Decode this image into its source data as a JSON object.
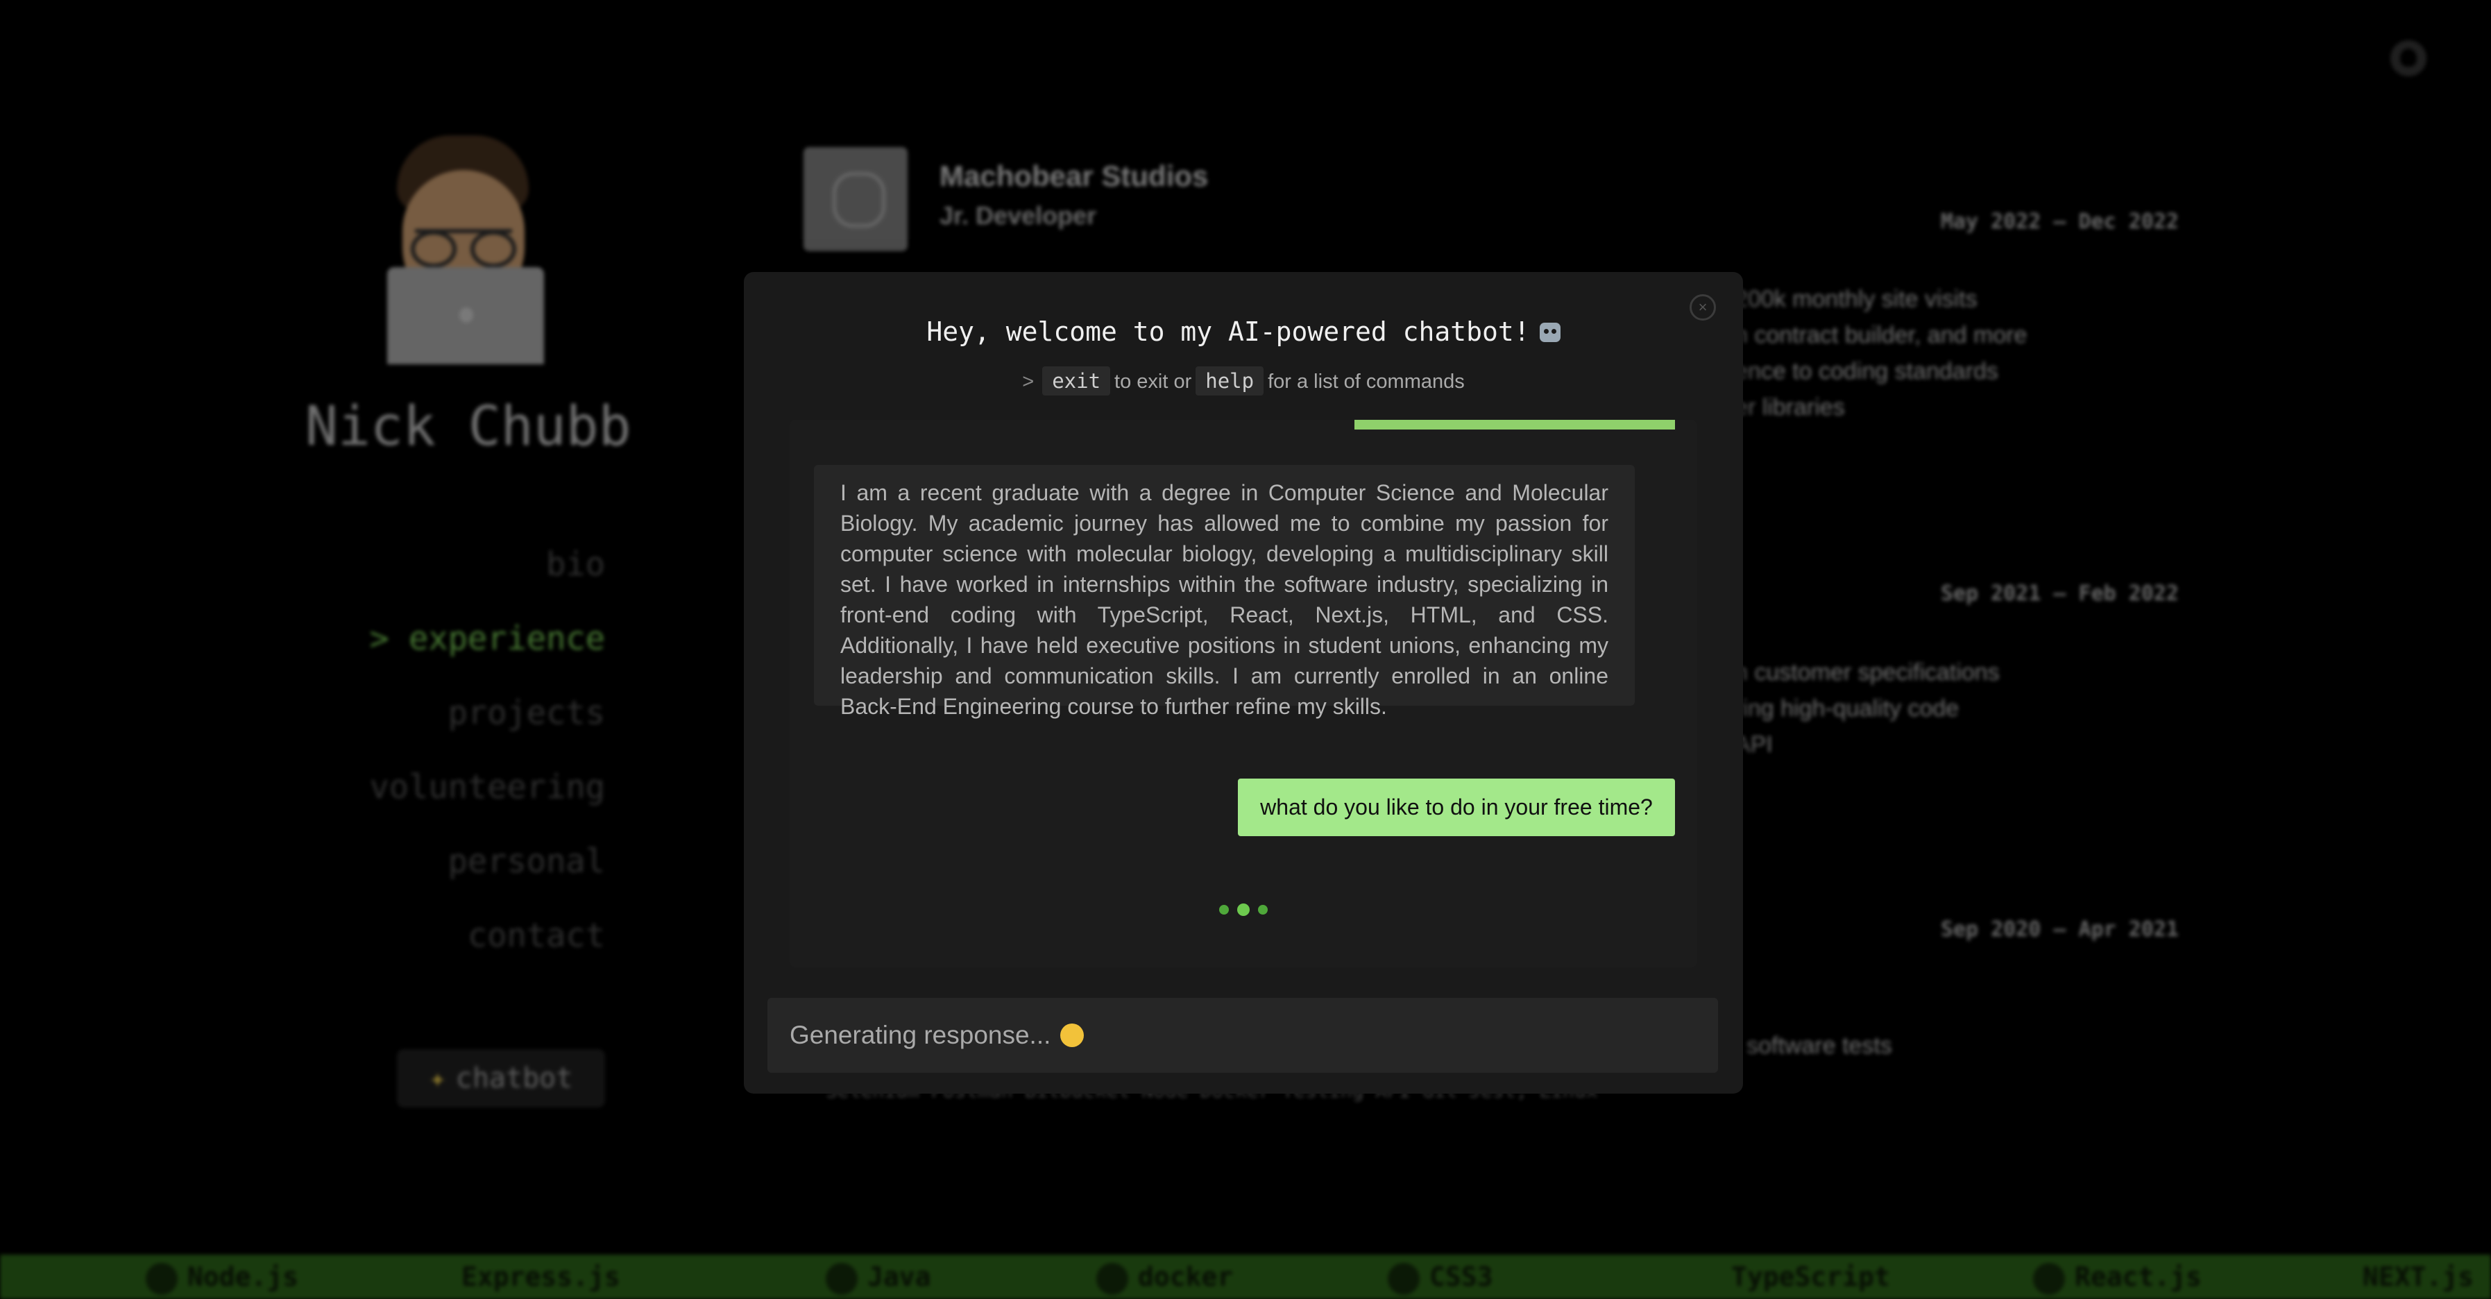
{
  "profile": {
    "name": "Nick Chubb"
  },
  "nav": {
    "items": [
      "bio",
      "experience",
      "projects",
      "volunteering",
      "personal",
      "contact"
    ],
    "active": "experience",
    "chatbot_label": "chatbot"
  },
  "experience": {
    "company": "Machobear Studios",
    "role": "Jr. Developer",
    "dates": [
      "May 2022 – Dec 2022",
      "Sep 2021 – Feb 2022",
      "Sep 2020 – Apr 2021"
    ],
    "bullets_1": [
      "200k monthly site visits",
      "n contract builder, and more",
      "ence to coding standards",
      "er libraries"
    ],
    "bullets_2": [
      "h customer specifications",
      "ring high-quality code",
      "API"
    ],
    "bullets_3": [
      "l software tests"
    ],
    "skills_line": "Selenium  Postman  Bitbucket  Node  Docker  Testing  API  Git  Jest, Linux"
  },
  "tech_ticker": [
    "Node.js",
    "Express.js",
    "Java",
    "docker",
    "CSS3",
    "TypeScript",
    "React.js",
    "NEXT.js"
  ],
  "chat": {
    "title": "Hey, welcome to my AI-powered chatbot!",
    "hint_prompt": ">",
    "hint_cmd_exit": "exit",
    "hint_text_1": "to exit or",
    "hint_cmd_help": "help",
    "hint_text_2": "for a list of commands",
    "bot_message": "I am a recent graduate with a degree in Computer Science and Molecular Biology. My academic journey has allowed me to combine my passion for computer science with molecular biology, developing a multidisciplinary skill set. I have worked in internships within the software industry, specializing in front-end coding with TypeScript, React, Next.js, HTML, and CSS. Additionally, I have held executive positions in student unions, enhancing my leadership and communication skills. I am currently enrolled in an online Back-End Engineering course to further refine my skills.",
    "user_message": "what do you like to do in your free time?",
    "input_status": "Generating response...",
    "close_label": "×"
  },
  "colors": {
    "accent": "#7fd65b",
    "user_bubble": "#a3e88a",
    "ticker_bg": "#2f6b1a"
  },
  "icons": [
    "github-icon",
    "robot-emoji-icon",
    "thinking-emoji-icon",
    "sparkles-icon",
    "close-icon"
  ]
}
